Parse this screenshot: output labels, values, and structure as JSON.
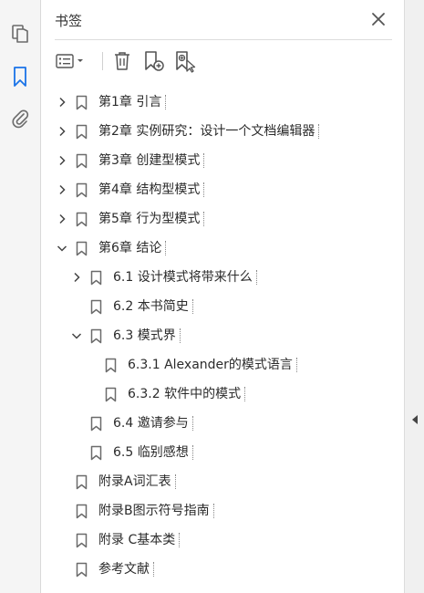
{
  "panel": {
    "title": "书签"
  },
  "rail": {
    "items": [
      {
        "icon": "pages-icon"
      },
      {
        "icon": "bookmark-icon",
        "active": true
      },
      {
        "icon": "attachment-icon"
      }
    ]
  },
  "toolbar": {
    "buttons": [
      {
        "icon": "options-menu-icon"
      },
      {
        "icon": "delete-icon"
      },
      {
        "icon": "new-bookmark-icon"
      },
      {
        "icon": "new-bookmark-from-structure-icon"
      }
    ]
  },
  "colors": {
    "accent": "#1a73e8",
    "icon_gray": "#6b6b6b"
  },
  "bookmarks": [
    {
      "label": "第1章 引言",
      "level": 0,
      "expander": "collapsed"
    },
    {
      "label": "第2章 实例研究：设计一个文档编辑器",
      "level": 0,
      "expander": "collapsed"
    },
    {
      "label": "第3章 创建型模式",
      "level": 0,
      "expander": "collapsed"
    },
    {
      "label": "第4章 结构型模式",
      "level": 0,
      "expander": "collapsed"
    },
    {
      "label": "第5章 行为型模式",
      "level": 0,
      "expander": "collapsed"
    },
    {
      "label": "第6章 结论",
      "level": 0,
      "expander": "expanded"
    },
    {
      "label": "6.1 设计模式将带来什么",
      "level": 1,
      "expander": "collapsed"
    },
    {
      "label": "6.2 本书简史",
      "level": 1,
      "expander": "none"
    },
    {
      "label": "6.3 模式界",
      "level": 1,
      "expander": "expanded"
    },
    {
      "label": "6.3.1 Alexander的模式语言",
      "level": 2,
      "expander": "none"
    },
    {
      "label": "6.3.2 软件中的模式",
      "level": 2,
      "expander": "none"
    },
    {
      "label": "6.4 邀请参与",
      "level": 1,
      "expander": "none"
    },
    {
      "label": "6.5 临别感想",
      "level": 1,
      "expander": "none"
    },
    {
      "label": "附录A词汇表",
      "level": 0,
      "expander": "none"
    },
    {
      "label": "附录B图示符号指南",
      "level": 0,
      "expander": "none"
    },
    {
      "label": "附录 C基本类",
      "level": 0,
      "expander": "none"
    },
    {
      "label": "参考文献",
      "level": 0,
      "expander": "none"
    }
  ]
}
